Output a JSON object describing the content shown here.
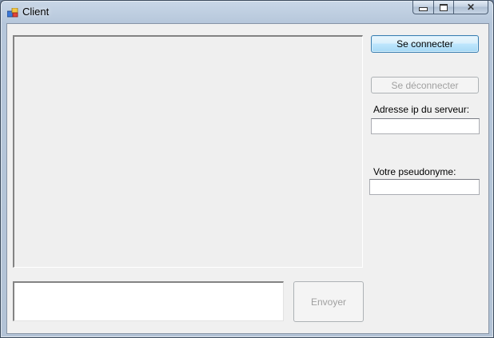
{
  "window": {
    "title": "Client",
    "icon": "app-window-icon",
    "caption_buttons": {
      "minimize": "minimize-icon",
      "maximize": "maximize-icon",
      "close": "close-icon"
    }
  },
  "chat": {
    "messages_text": "",
    "message_input_value": ""
  },
  "buttons": {
    "connect_label": "Se connecter",
    "disconnect_label": "Se déconnecter",
    "send_label": "Envoyer"
  },
  "fields": {
    "server_ip_label": "Adresse ip du serveur:",
    "server_ip_value": "",
    "nickname_label": "Votre pseudonyme:",
    "nickname_value": ""
  },
  "colors": {
    "client_background": "#f0f0f0",
    "disabled_text": "#a0a0a0",
    "focused_button_border": "#3c7fb1"
  }
}
